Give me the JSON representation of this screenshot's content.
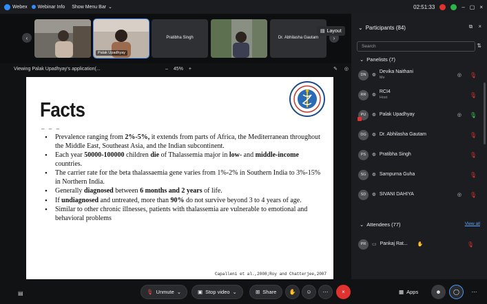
{
  "titlebar": {
    "app_name": "Webex",
    "webinar_info": "Webinar Info",
    "show_menu": "Show Menu Bar",
    "clock": "02:51:33",
    "minimize": "–",
    "maximize": "▢",
    "close": "×"
  },
  "strip": {
    "tiles": [
      {
        "name": ""
      },
      {
        "name": "Palak Upadhyay"
      },
      {
        "name": "Pratibha Singh"
      },
      {
        "name": ""
      },
      {
        "name": "Dr. Abhilasha Gautam"
      }
    ],
    "layout_label": "Layout"
  },
  "viewbar": {
    "text": "Viewing Palak Upadhyay's application(...",
    "zoom_minus": "–",
    "zoom_level": "45%",
    "zoom_plus": "+"
  },
  "slide": {
    "title": "Facts",
    "dash": "– – –",
    "bullets": [
      {
        "html": "Prevalence ranging from <b>2%-5%,</b> it extends from parts of Africa, the Mediterranean throughout the Middle East, Southeast Asia, and the Indian subcontinent."
      },
      {
        "html": "Each year <b>50000-100000</b> children <b>die</b> of Thalassemia major in <b>low</b>- and <b>middle-income</b> countries."
      },
      {
        "html": "The carrier rate for the beta thalassaemia gene varies from 1%-2% in Southern India to 3%-15% in Northern India."
      },
      {
        "html": "Generally <b>diagnosed</b> between <b>6 months and 2 years</b> of life."
      },
      {
        "html": "If <b>undiagnosed</b> and untreated, more than <b>90%</b> do not survive beyond 3 to 4 years of age."
      },
      {
        "html": "Similar to other chronic illnesses, patients with thalassemia are vulnerable to emotional and behavioral problems"
      }
    ],
    "citation": "Capalleni et al.,2008;Roy and Chatterjee,2007"
  },
  "panel": {
    "header": "Participants (84)",
    "search_placeholder": "Search",
    "panelists_header": "Panelists (7)",
    "panelists": [
      {
        "initials": "DN",
        "name": "Devika Naithani",
        "sub": "Me",
        "camera": true,
        "mic": "muted"
      },
      {
        "initials": "RR",
        "name": "RCI4",
        "sub": "Host",
        "camera": false,
        "mic": "muted"
      },
      {
        "initials": "PU",
        "name": "Palak Upadhyay",
        "sub": "",
        "camera": true,
        "mic": "on"
      },
      {
        "initials": "DG",
        "name": "Dr. Abhilasha Gautam",
        "sub": "",
        "camera": false,
        "mic": "muted"
      },
      {
        "initials": "PS",
        "name": "Pratibha Singh",
        "sub": "",
        "camera": false,
        "mic": "muted"
      },
      {
        "initials": "SG",
        "name": "Sampurna Guha",
        "sub": "",
        "camera": false,
        "mic": "muted"
      },
      {
        "initials": "SD",
        "name": "SIVANI DAHIYA",
        "sub": "",
        "camera": true,
        "mic": "muted"
      }
    ],
    "attendees_header": "Attendees (77)",
    "view_all": "View all",
    "attendees": [
      {
        "initials": "PR",
        "name": "Pankaj Rat..."
      }
    ]
  },
  "bottom": {
    "unmute": "Unmute",
    "stop_video": "Stop video",
    "share": "Share",
    "apps": "Apps"
  },
  "colors": {
    "accent": "#4a9bff",
    "muted_red": "#e0322e",
    "mic_green": "#3fc55a"
  }
}
